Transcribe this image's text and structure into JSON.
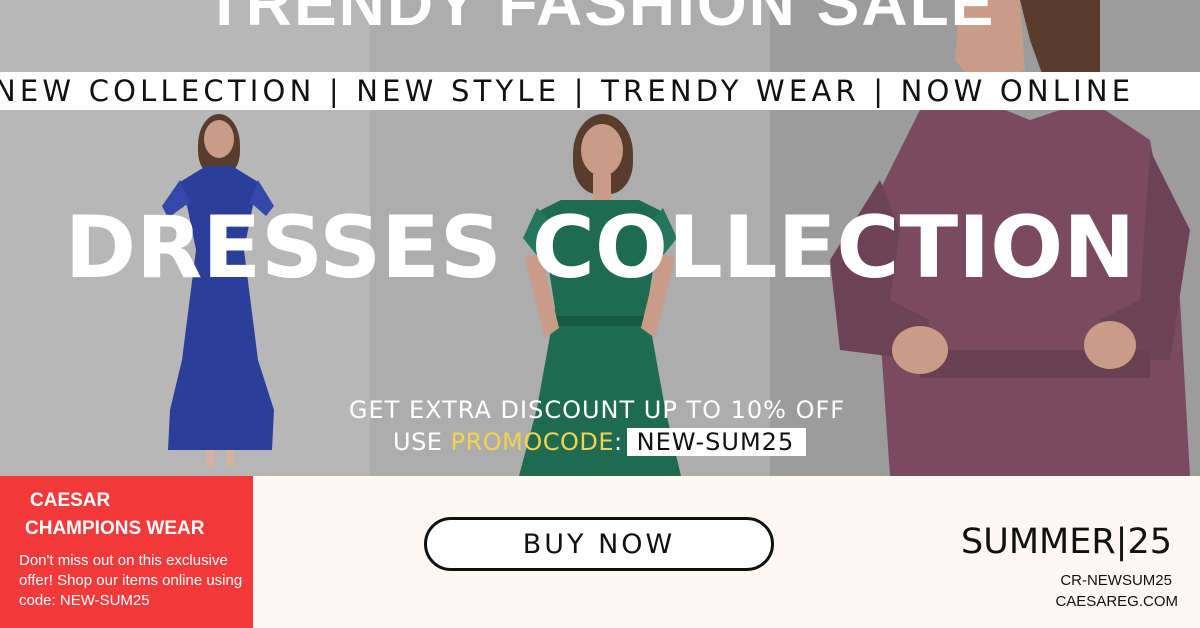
{
  "banner": {
    "top_title": "TRENDY FASHION SALE",
    "ticker_text": "NEW COLLECTION | NEW STYLE | TRENDY WEAR | NOW ONLINE",
    "main_title": "DRESSES COLLECTION",
    "discount_text": "GET EXTRA DISCOUNT UP TO 10% OFF",
    "promo_prefix": "USE ",
    "promo_word": "PROMOCODE",
    "promo_colon": ":",
    "promo_code": "NEW-SUM25"
  },
  "brand_box": {
    "line1": "CAESAR",
    "line2": "CHAMPIONS WEAR",
    "offer_text": "Don't miss out on this exclusive offer! Shop our items online using code: NEW-SUM25"
  },
  "cta": {
    "buy_label": "BUY NOW"
  },
  "footer_right": {
    "season": "SUMMER|25",
    "code": "CR-NEWSUM25",
    "website": "CAESAREG.COM"
  },
  "models": [
    {
      "dress_color": "#2b3f9a"
    },
    {
      "dress_color": "#1f6b52"
    },
    {
      "dress_color": "#7a4a5e"
    }
  ],
  "colors": {
    "accent_red": "#f4393a",
    "promo_yellow": "#f2d34b",
    "background": "#fdf8f6"
  }
}
